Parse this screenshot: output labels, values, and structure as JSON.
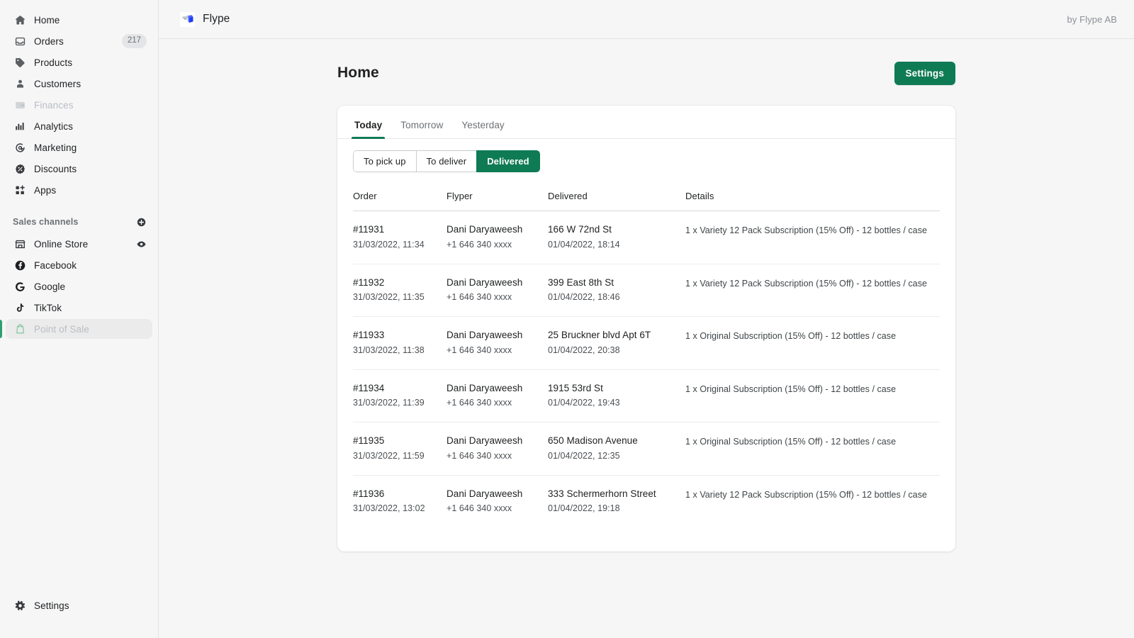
{
  "sidebar": {
    "nav": [
      {
        "label": "Home",
        "icon": "home-icon",
        "state": "normal"
      },
      {
        "label": "Orders",
        "icon": "orders-icon",
        "state": "normal",
        "badge": "217"
      },
      {
        "label": "Products",
        "icon": "products-icon",
        "state": "normal"
      },
      {
        "label": "Customers",
        "icon": "customers-icon",
        "state": "normal"
      },
      {
        "label": "Finances",
        "icon": "finances-icon",
        "state": "disabled"
      },
      {
        "label": "Analytics",
        "icon": "analytics-icon",
        "state": "normal"
      },
      {
        "label": "Marketing",
        "icon": "marketing-icon",
        "state": "normal"
      },
      {
        "label": "Discounts",
        "icon": "discounts-icon",
        "state": "normal"
      },
      {
        "label": "Apps",
        "icon": "apps-icon",
        "state": "normal"
      }
    ],
    "sales_channels": {
      "title": "Sales channels",
      "add_icon": "circle-plus-icon",
      "items": [
        {
          "label": "Online Store",
          "icon": "storefront-icon",
          "trailing_icon": "eye-icon"
        },
        {
          "label": "Facebook",
          "icon": "facebook-icon"
        },
        {
          "label": "Google",
          "icon": "google-icon"
        },
        {
          "label": "TikTok",
          "icon": "tiktok-icon"
        },
        {
          "label": "Point of Sale",
          "icon": "point-of-sale-icon",
          "state": "selected-dim"
        }
      ]
    },
    "settings": {
      "label": "Settings",
      "icon": "gear-icon"
    }
  },
  "topbar": {
    "app_name": "Flype",
    "logo_icon": "flype-logo-icon",
    "byline": "by Flype AB"
  },
  "page": {
    "title": "Home",
    "settings_button": "Settings"
  },
  "tabs": [
    {
      "label": "Today",
      "active": true
    },
    {
      "label": "Tomorrow",
      "active": false
    },
    {
      "label": "Yesterday",
      "active": false
    }
  ],
  "segmented": [
    {
      "label": "To pick up",
      "active": false
    },
    {
      "label": "To deliver",
      "active": false
    },
    {
      "label": "Delivered",
      "active": true
    }
  ],
  "table": {
    "columns": [
      "Order",
      "Flyper",
      "Delivered",
      "Details"
    ],
    "rows": [
      {
        "order_id": "#11931",
        "order_time": "31/03/2022, 11:34",
        "flyper_name": "Dani Daryaweesh",
        "flyper_phone": "+1 646 340 xxxx",
        "address": "166 W 72nd St",
        "delivered_time": "01/04/2022, 18:14",
        "details": "1 x Variety 12 Pack Subscription (15% Off) - 12 bottles / case"
      },
      {
        "order_id": "#11932",
        "order_time": "31/03/2022, 11:35",
        "flyper_name": "Dani Daryaweesh",
        "flyper_phone": "+1 646 340 xxxx",
        "address": "399 East 8th St",
        "delivered_time": "01/04/2022, 18:46",
        "details": "1 x Variety 12 Pack Subscription (15% Off) - 12 bottles / case"
      },
      {
        "order_id": "#11933",
        "order_time": "31/03/2022, 11:38",
        "flyper_name": "Dani Daryaweesh",
        "flyper_phone": "+1 646 340 xxxx",
        "address": "25 Bruckner blvd Apt 6T",
        "delivered_time": "01/04/2022, 20:38",
        "details": "1 x Original Subscription (15% Off) - 12 bottles / case"
      },
      {
        "order_id": "#11934",
        "order_time": "31/03/2022, 11:39",
        "flyper_name": "Dani Daryaweesh",
        "flyper_phone": "+1 646 340 xxxx",
        "address": "1915 53rd St",
        "delivered_time": "01/04/2022, 19:43",
        "details": "1 x Original Subscription (15% Off) - 12 bottles / case"
      },
      {
        "order_id": "#11935",
        "order_time": "31/03/2022, 11:59",
        "flyper_name": "Dani Daryaweesh",
        "flyper_phone": "+1 646 340 xxxx",
        "address": "650 Madison Avenue",
        "delivered_time": "01/04/2022, 12:35",
        "details": "1 x Original Subscription (15% Off) - 12 bottles / case"
      },
      {
        "order_id": "#11936",
        "order_time": "31/03/2022, 13:02",
        "flyper_name": "Dani Daryaweesh",
        "flyper_phone": "+1 646 340 xxxx",
        "address": "333 Schermerhorn Street",
        "delivered_time": "01/04/2022, 19:18",
        "details": "1 x Variety 12 Pack Subscription (15% Off) - 12 bottles / case"
      }
    ]
  },
  "colors": {
    "accent_green": "#0f7b55",
    "selected_bar": "#2e9e71",
    "sidebar_bg": "#f6f6f7",
    "page_bg": "#f6f6f7",
    "card_bg": "#ffffff",
    "text_primary": "#202223",
    "text_muted": "#6d7175",
    "text_disabled": "#babec3"
  }
}
